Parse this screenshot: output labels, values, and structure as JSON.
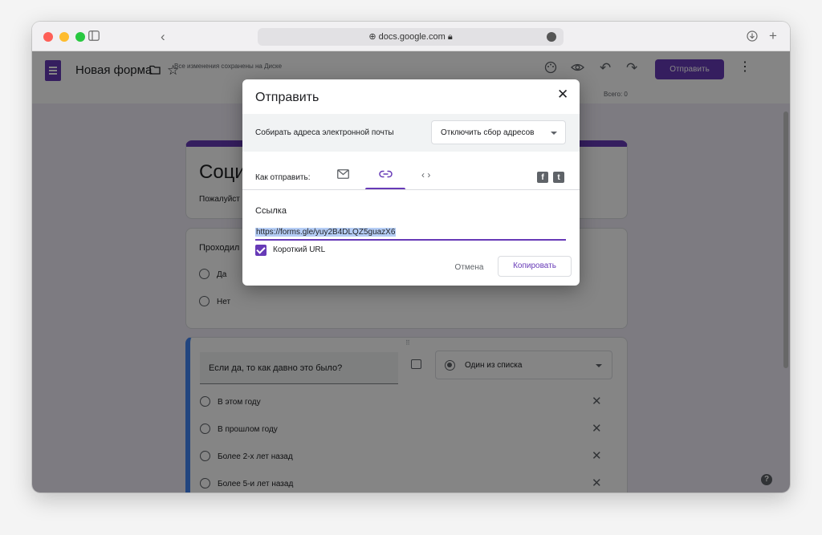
{
  "browser": {
    "address": "docs.google.com"
  },
  "header": {
    "form_title": "Новая форма",
    "save_status": "Все изменения сохранены на Диске",
    "send_label": "Отправить",
    "totals": "Всего: 0"
  },
  "form": {
    "title": "Соци",
    "description": "Пожалуйст",
    "q1": {
      "text": "Проходил",
      "options": [
        "Да",
        "Нет"
      ]
    },
    "q2": {
      "text": "Если да, то как давно это было?",
      "type": "Один из списка",
      "options": [
        "В этом году",
        "В прошлом году",
        "Более 2-х лет назад",
        "Более 5-и лет назад"
      ]
    }
  },
  "dialog": {
    "title": "Отправить",
    "collect_label": "Собирать адреса электронной почты",
    "collect_value": "Отключить сбор адресов",
    "how_label": "Как отправить:",
    "link_label": "Ссылка",
    "link_value": "https://forms.gle/yuy2B4DLQZ5guazX6",
    "short_url_label": "Короткий URL",
    "short_url_checked": true,
    "cancel_label": "Отмена",
    "copy_label": "Копировать"
  },
  "colors": {
    "accent": "#673ab7",
    "page_bg": "#f0ebf8",
    "question_focus": "#4285f4"
  }
}
